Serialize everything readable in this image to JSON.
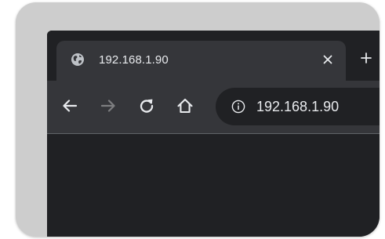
{
  "tab": {
    "title": "192.168.1.90",
    "favicon_icon": "globe-icon",
    "close_icon": "close-icon"
  },
  "new_tab_icon": "plus-icon",
  "toolbar": {
    "back_icon": "arrow-left-icon",
    "forward_icon": "arrow-right-icon",
    "forward_enabled": false,
    "reload_icon": "reload-icon",
    "home_icon": "home-icon"
  },
  "omnibox": {
    "info_icon": "info-icon",
    "url": "192.168.1.90"
  },
  "colors": {
    "frame": "#202124",
    "active_tab": "#35363a",
    "toolbar": "#35363a",
    "omnibox": "#202124",
    "text": "#e8eaed",
    "disabled_icon": "#7d7e80"
  }
}
